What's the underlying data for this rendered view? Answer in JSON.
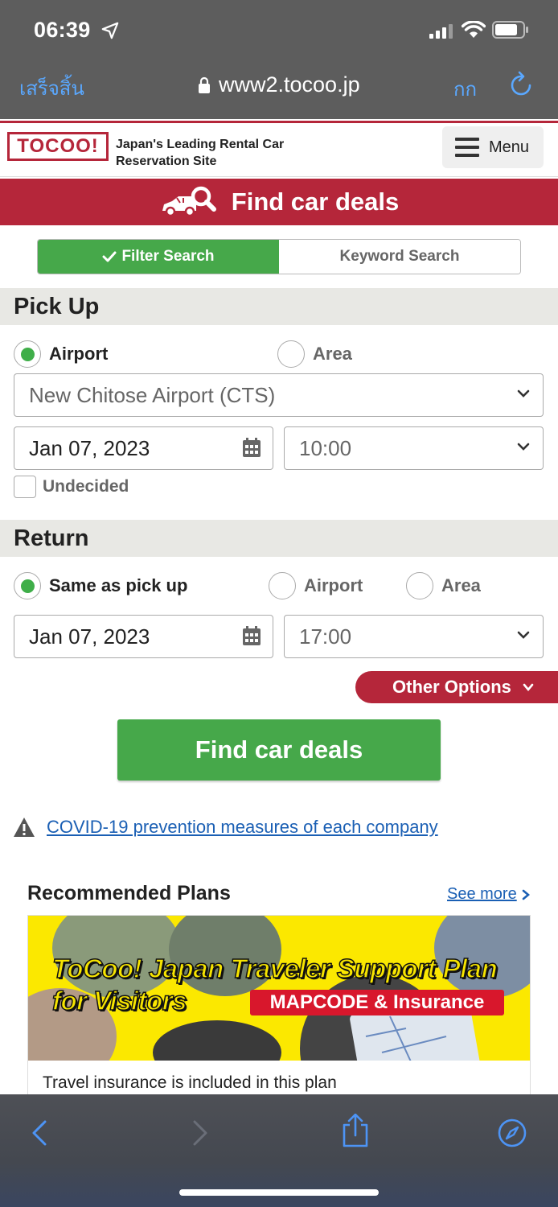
{
  "status_bar": {
    "time": "06:39"
  },
  "browser": {
    "done_label": "เสร็จสิ้น",
    "url": "www2.tocoo.jp",
    "text_size_label": "กก"
  },
  "header": {
    "logo": "TOCOO!",
    "tagline_line1": "Japan's Leading Rental Car",
    "tagline_line2": "Reservation Site",
    "menu_label": "Menu"
  },
  "banner": {
    "title": "Find car deals"
  },
  "search_tabs": {
    "filter_label": "Filter Search",
    "keyword_label": "Keyword Search",
    "active": "filter"
  },
  "pickup": {
    "heading": "Pick Up",
    "option_airport": "Airport",
    "option_area": "Area",
    "location": "New Chitose Airport (CTS)",
    "date": "Jan 07, 2023",
    "time": "10:00",
    "undecided_label": "Undecided"
  },
  "return": {
    "heading": "Return",
    "option_same": "Same as pick up",
    "option_airport": "Airport",
    "option_area": "Area",
    "date": "Jan 07, 2023",
    "time": "17:00"
  },
  "other_options_label": "Other Options",
  "find_button_label": "Find car deals",
  "covid_link": "COVID-19 prevention measures of each company",
  "recommended": {
    "title": "Recommended Plans",
    "see_more": "See more",
    "plan": {
      "image_title_line1": "ToCoo! Japan Traveler Support Plan",
      "image_title_line2": "for Visitors",
      "image_badge": "MAPCODE & Insurance",
      "description": "Travel insurance is included in this plan"
    }
  },
  "colors": {
    "brand_red": "#b5263a",
    "action_green": "#46a84a",
    "link_blue": "#1a5fb4",
    "ios_blue": "#5aa8ff"
  }
}
